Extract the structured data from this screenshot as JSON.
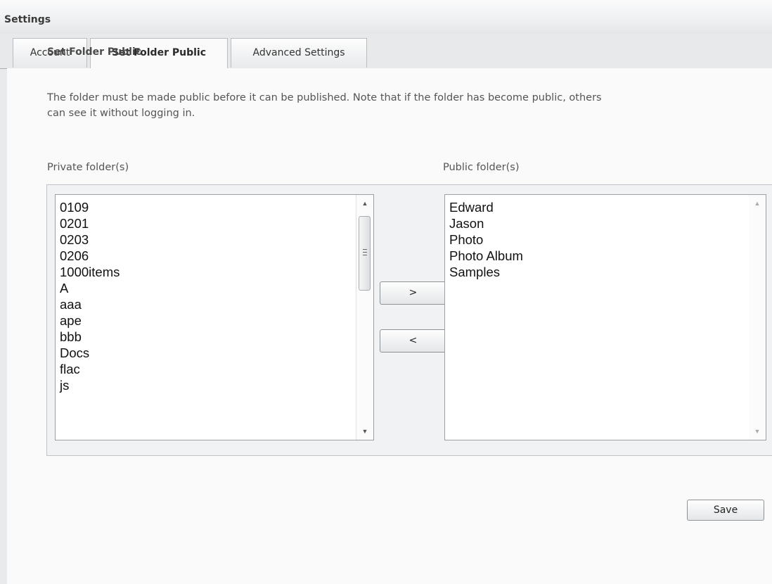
{
  "window": {
    "title": "Settings"
  },
  "tabs": [
    {
      "label": "Account",
      "active": false
    },
    {
      "label": "Set Folder Public",
      "active": true
    },
    {
      "label": "Advanced Settings",
      "active": false
    }
  ],
  "section": {
    "title": "Set Folder Public",
    "description": "The folder must be made public before it can be published. Note that if the folder has become public, others\ncan see it without logging in."
  },
  "private_list": {
    "label": "Private folder(s)",
    "items": [
      "0109",
      "0201",
      "0203",
      "0206",
      "1000items",
      "A",
      "aaa",
      "ape",
      "bbb",
      "Docs",
      "flac",
      "js"
    ]
  },
  "public_list": {
    "label": "Public folder(s)",
    "items": [
      "Edward",
      "Jason",
      "Photo",
      "Photo Album",
      "Samples"
    ]
  },
  "buttons": {
    "move_right": ">",
    "move_left": "<",
    "save": "Save"
  },
  "colors": {
    "panel_bg": "#fafafa",
    "list_bg": "#ffffff",
    "text": "#555555"
  }
}
